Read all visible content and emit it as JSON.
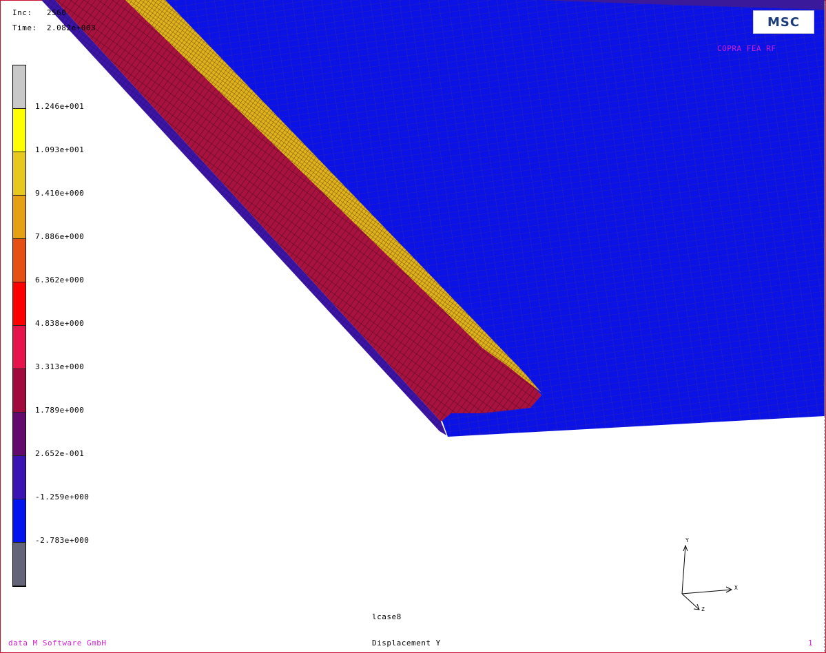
{
  "header": {
    "inc_label": "Inc:",
    "inc_value": "2560",
    "time_label": "Time:",
    "time_value": "2.082e+003"
  },
  "logo": {
    "text": "MSC"
  },
  "model_title": "COPRA FEA RF",
  "legend": {
    "bands": [
      {
        "color": "#c8c8c8"
      },
      {
        "color": "#ffff00"
      },
      {
        "color": "#e6c81e"
      },
      {
        "color": "#e6a014"
      },
      {
        "color": "#e65014"
      },
      {
        "color": "#ff0000"
      },
      {
        "color": "#e6144b"
      },
      {
        "color": "#a00a3c"
      },
      {
        "color": "#640a6e"
      },
      {
        "color": "#3c14b4"
      },
      {
        "color": "#0014f0"
      },
      {
        "color": "#646478"
      }
    ],
    "labels": [
      "1.246e+001",
      "1.093e+001",
      "9.410e+000",
      "7.886e+000",
      "6.362e+000",
      "4.838e+000",
      "3.313e+000",
      "1.789e+000",
      "2.652e-001",
      "-1.259e+000",
      "-2.783e+000"
    ]
  },
  "axes": {
    "y": "Y",
    "x": "X",
    "z": "Z"
  },
  "footer": {
    "loadcase": "lcase8",
    "company": "data M Software GmbH",
    "quantity": "Displacement Y",
    "page": "1"
  }
}
